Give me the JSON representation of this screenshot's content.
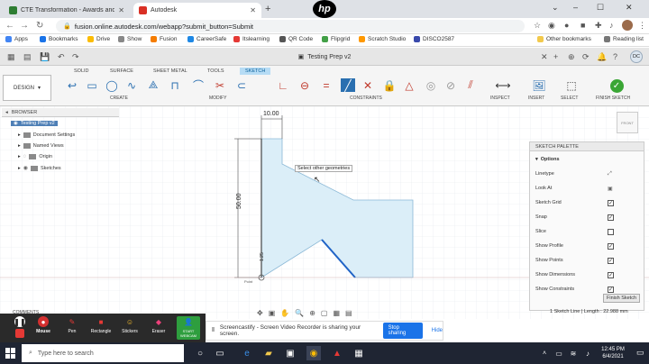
{
  "tabs": [
    {
      "title": "CTE Transformation - Awards and…",
      "favicon_color": "#2e7d32"
    },
    {
      "title": "Autodesk",
      "favicon_color": "#d93025"
    }
  ],
  "address": {
    "url": "fusion.online.autodesk.com/webapp?submit_button=Submit"
  },
  "bookmarks": [
    "Apps",
    "Bookmarks",
    "Drive",
    "Show",
    "Fusion",
    "CareerSafe",
    "Itslearning",
    "QR Code",
    "Flipgrid",
    "Scratch Studio",
    "DISCO2587"
  ],
  "bookmarks_right": [
    "Other bookmarks",
    "Reading list"
  ],
  "fusion": {
    "doc_title": "Testing Prep v2",
    "user_initials": "DC"
  },
  "ribbon": {
    "tabs": [
      "SOLID",
      "SURFACE",
      "SHEET METAL",
      "TOOLS",
      "SKETCH"
    ],
    "active_tab": "SKETCH",
    "workspace": "DESIGN",
    "groups": [
      "CREATE",
      "MODIFY",
      "CONSTRAINTS",
      "INSPECT",
      "INSERT",
      "SELECT",
      "FINISH SKETCH"
    ]
  },
  "browser": {
    "title": "BROWSER",
    "root": "Testing Prep v2",
    "items": [
      "Document Settings",
      "Named Views",
      "Origin",
      "Sketches"
    ]
  },
  "sketch": {
    "dim_top": "10.00",
    "dim_left": "50.00",
    "dim_small": "1.25",
    "tooltip": "Select other geometries",
    "origin_label": "Point"
  },
  "palette": {
    "title": "SKETCH PALETTE",
    "section": "Options",
    "rows": [
      {
        "label": "Linetype",
        "kind": "icon"
      },
      {
        "label": "Look At",
        "kind": "icon"
      },
      {
        "label": "Sketch Grid",
        "kind": "check",
        "checked": true
      },
      {
        "label": "Snap",
        "kind": "check",
        "checked": true
      },
      {
        "label": "Slice",
        "kind": "check",
        "checked": false
      },
      {
        "label": "Show Profile",
        "kind": "check",
        "checked": true
      },
      {
        "label": "Show Points",
        "kind": "check",
        "checked": true
      },
      {
        "label": "Show Dimensions",
        "kind": "check",
        "checked": true
      },
      {
        "label": "Show Constraints",
        "kind": "check",
        "checked": true
      }
    ],
    "finish_label": "Finish Sketch"
  },
  "status": {
    "text": "1 Sketch Line | Length : 22.988 mm",
    "comments": "COMMENTS"
  },
  "screencastify": {
    "tools": [
      "Mouse",
      "Pen",
      "Rectangle",
      "Stickers",
      "Eraser",
      "START WEBCAM"
    ],
    "share_text": "Screencastify - Screen Video Recorder is sharing your screen.",
    "stop_label": "Stop sharing",
    "hide_label": "Hide"
  },
  "taskbar": {
    "search_placeholder": "Type here to search",
    "time": "12:45 PM",
    "date": "6/4/2021"
  },
  "colors": {
    "accent": "#2a6fb0",
    "profile_fill": "#dbeef8",
    "finish_green": "#3aa635",
    "stop_blue": "#1a73e8"
  }
}
